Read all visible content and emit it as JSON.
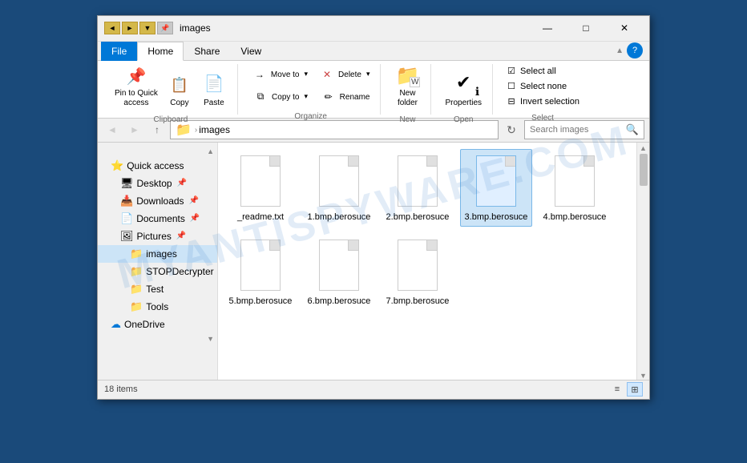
{
  "window": {
    "title": "images",
    "item_count": "18 items"
  },
  "titlebar": {
    "icons": [
      "■",
      "■",
      "■"
    ],
    "title": "images",
    "minimize": "—",
    "maximize": "□",
    "close": "✕"
  },
  "ribbon": {
    "tabs": [
      "File",
      "Home",
      "Share",
      "View"
    ],
    "active_tab": "Home",
    "groups": {
      "clipboard": {
        "label": "Clipboard",
        "buttons": [
          {
            "id": "pin",
            "icon": "📌",
            "label": "Pin to Quick\naccess"
          },
          {
            "id": "copy",
            "icon": "📋",
            "label": "Copy"
          },
          {
            "id": "paste",
            "icon": "📄",
            "label": "Paste"
          }
        ]
      },
      "organize": {
        "label": "Organize",
        "buttons": [
          {
            "id": "move_to",
            "icon": "→",
            "label": "Move to"
          },
          {
            "id": "copy_to",
            "icon": "⧉",
            "label": "Copy to"
          },
          {
            "id": "delete",
            "icon": "✕",
            "label": "Delete"
          },
          {
            "id": "rename",
            "icon": "✏",
            "label": "Rename"
          }
        ]
      },
      "new": {
        "label": "New",
        "buttons": [
          {
            "id": "new_folder",
            "icon": "📁",
            "label": "New\nfolder"
          }
        ]
      },
      "open": {
        "label": "Open",
        "buttons": [
          {
            "id": "properties",
            "icon": "ℹ",
            "label": "Properties"
          }
        ]
      },
      "select": {
        "label": "Select",
        "items": [
          {
            "id": "select_all",
            "label": "Select all"
          },
          {
            "id": "select_none",
            "label": "Select none"
          },
          {
            "id": "invert_selection",
            "label": "Invert selection"
          }
        ]
      }
    }
  },
  "addressbar": {
    "back_disabled": true,
    "forward_disabled": true,
    "up": "↑",
    "address": "images",
    "path_parts": [
      "images"
    ],
    "search_placeholder": "Search images"
  },
  "sidebar": {
    "items": [
      {
        "id": "quick_access",
        "label": "Quick access",
        "icon": "⭐",
        "type": "section",
        "indent": 0
      },
      {
        "id": "desktop",
        "label": "Desktop",
        "icon": "🖥",
        "type": "item",
        "indent": 1,
        "pinned": true
      },
      {
        "id": "downloads",
        "label": "Downloads",
        "icon": "📥",
        "type": "item",
        "indent": 1,
        "pinned": true
      },
      {
        "id": "documents",
        "label": "Documents",
        "icon": "📄",
        "type": "item",
        "indent": 1,
        "pinned": true
      },
      {
        "id": "pictures",
        "label": "Pictures",
        "icon": "🖼",
        "type": "item",
        "indent": 1,
        "pinned": true
      },
      {
        "id": "images",
        "label": "images",
        "icon": "📁",
        "type": "item",
        "indent": 2,
        "selected": true
      },
      {
        "id": "stopDecrypter",
        "label": "STOPDecrypter",
        "icon": "📁",
        "type": "item",
        "indent": 2
      },
      {
        "id": "test",
        "label": "Test",
        "icon": "📁",
        "type": "item",
        "indent": 2
      },
      {
        "id": "tools",
        "label": "Tools",
        "icon": "📁",
        "type": "item",
        "indent": 2
      },
      {
        "id": "onedrive",
        "label": "OneDrive",
        "icon": "☁",
        "type": "item",
        "indent": 0
      }
    ]
  },
  "files": [
    {
      "id": "readme",
      "name": "_readme.txt",
      "selected": false
    },
    {
      "id": "1bmp",
      "name": "1.bmp.berosuce",
      "selected": false
    },
    {
      "id": "2bmp",
      "name": "2.bmp.berosuce",
      "selected": false
    },
    {
      "id": "3bmp",
      "name": "3.bmp.berosuce",
      "selected": true
    },
    {
      "id": "4bmp",
      "name": "4.bmp.berosuce",
      "selected": false
    },
    {
      "id": "5bmp",
      "name": "5.bmp.berosuce",
      "selected": false
    },
    {
      "id": "6bmp",
      "name": "6.bmp.berosuce",
      "selected": false
    },
    {
      "id": "7bmp",
      "name": "7.bmp.berosuce",
      "selected": false
    }
  ],
  "statusbar": {
    "item_count": "18 items"
  },
  "watermark": "MYANTISPYWARE.COM"
}
